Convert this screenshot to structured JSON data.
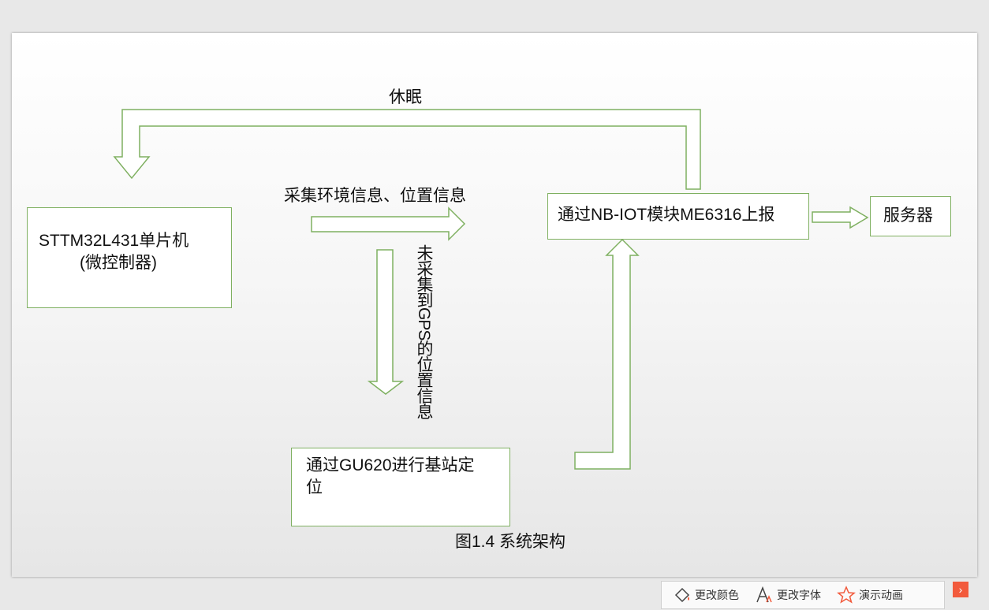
{
  "diagram": {
    "mcu": {
      "line1": "STTM32L431单片机",
      "line2": "(微控制器)"
    },
    "gps_box": {
      "text": "通过GU620进行基站定位"
    },
    "nb_box": {
      "text": "通过NB-IOT模块ME6316上报"
    },
    "server": {
      "text": "服务器"
    },
    "sleep_label": "休眠",
    "collect_label": "采集环境信息、位置信息",
    "no_gps_label": "未采集到GPS的位置信息",
    "caption": "图1.4 系统架构",
    "colors": {
      "arrow_stroke": "#7fb061",
      "box_border": "#7fb061"
    }
  },
  "toolbar": {
    "items": [
      {
        "label": "更改颜色",
        "icon": "paint-bucket-icon"
      },
      {
        "label": "更改字体",
        "icon": "font-icon"
      },
      {
        "label": "演示动画",
        "icon": "star-icon"
      }
    ],
    "next_glyph": "›"
  }
}
